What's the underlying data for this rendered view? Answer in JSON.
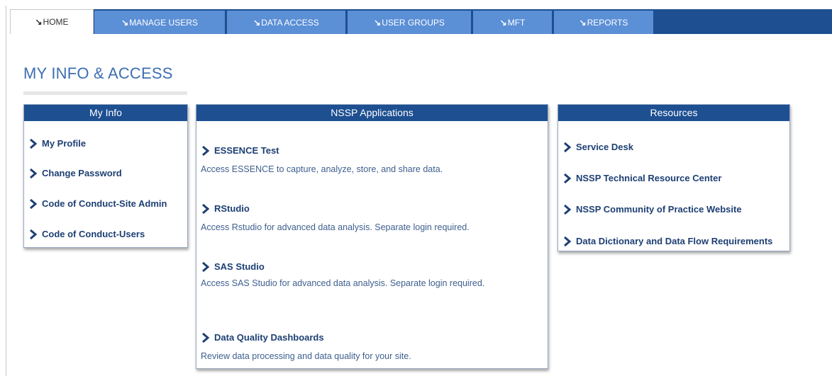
{
  "tabs": [
    {
      "label": "HOME",
      "active": true
    },
    {
      "label": "MANAGE USERS",
      "active": false
    },
    {
      "label": "DATA ACCESS",
      "active": false
    },
    {
      "label": "USER GROUPS",
      "active": false
    },
    {
      "label": "MFT",
      "active": false
    },
    {
      "label": "REPORTS",
      "active": false
    }
  ],
  "page": {
    "title": "MY INFO & ACCESS"
  },
  "my_info": {
    "header": "My Info",
    "links": [
      "My Profile",
      "Change Password",
      "Code of Conduct-Site Admin",
      "Code of Conduct-Users"
    ]
  },
  "apps": {
    "header": "NSSP Applications",
    "items": [
      {
        "title": "ESSENCE Test",
        "desc": "Access ESSENCE to capture, analyze, store, and share data."
      },
      {
        "title": "RStudio",
        "desc": "Access Rstudio for advanced data analysis. Separate login required."
      },
      {
        "title": "SAS Studio",
        "desc": "Access SAS Studio for advanced data analysis. Separate login required."
      },
      {
        "title": "Data Quality Dashboards",
        "desc": "Review data processing and data quality for your site."
      }
    ]
  },
  "resources": {
    "header": "Resources",
    "links": [
      "Service Desk",
      "NSSP Technical Resource Center",
      "NSSP Community of Practice Website",
      "Data Dictionary and Data Flow Requirements"
    ]
  },
  "colors": {
    "nav": "#1d4f91",
    "tab": "#5b8fd6",
    "title": "#3d6eb4",
    "link": "#1d3f73"
  },
  "icons": {
    "tab_marker": "arrow-tick-icon",
    "link_marker": "chevron-right-icon"
  }
}
